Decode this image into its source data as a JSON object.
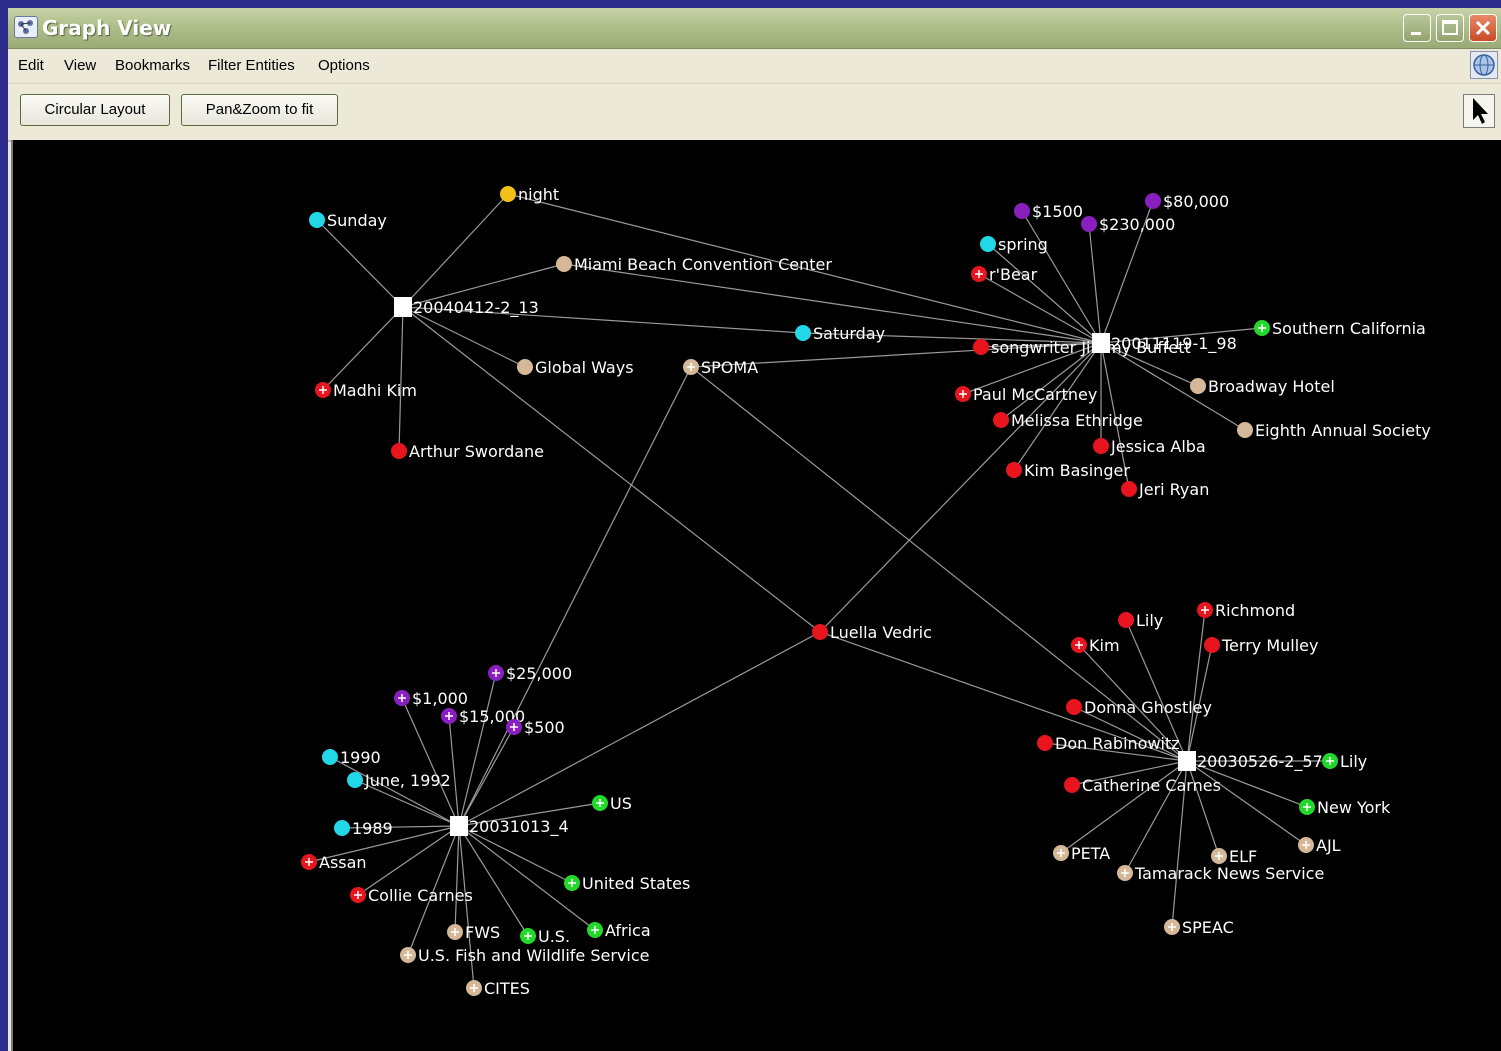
{
  "window": {
    "title": "Graph View"
  },
  "menu": {
    "items": [
      "Edit",
      "View",
      "Bookmarks",
      "Filter Entities",
      "Options"
    ]
  },
  "toolbar": {
    "circular_layout_label": "Circular Layout",
    "pan_zoom_label": "Pan&Zoom to fit",
    "pointer_icon": "arrow-pointer-icon"
  },
  "colors": {
    "window_bg": "#ece9d8",
    "canvas_bg": "#000000",
    "edge": "#9a9a9a",
    "person": "#e8141e",
    "money": "#8a1fc0",
    "date": "#22d7e6",
    "location": "#22d82a",
    "organization": "#d4b898",
    "time": "#f2c018",
    "document": "#ffffff"
  },
  "graph": {
    "nodes": [
      {
        "id": "d1",
        "label": "20040412-2_13",
        "type": "document"
      },
      {
        "id": "d2",
        "label": "20011119-1_98",
        "type": "document"
      },
      {
        "id": "d3",
        "label": "20031013_4",
        "type": "document"
      },
      {
        "id": "d4",
        "label": "20030526-2_57",
        "type": "document"
      },
      {
        "id": "n1",
        "label": "night",
        "type": "time"
      },
      {
        "id": "n2",
        "label": "Sunday",
        "type": "date"
      },
      {
        "id": "n3",
        "label": "Miami Beach Convention Center",
        "type": "organization"
      },
      {
        "id": "n4",
        "label": "Madhi Kim",
        "type": "person",
        "plus": true
      },
      {
        "id": "n5",
        "label": "Arthur Swordane",
        "type": "person"
      },
      {
        "id": "n6",
        "label": "Global Ways",
        "type": "organization"
      },
      {
        "id": "n7",
        "label": "Saturday",
        "type": "date"
      },
      {
        "id": "n8",
        "label": "SPOMA",
        "type": "organization",
        "plus": true
      },
      {
        "id": "n9",
        "label": "$1500",
        "type": "money"
      },
      {
        "id": "n10",
        "label": "$80,000",
        "type": "money"
      },
      {
        "id": "n11",
        "label": "$230,000",
        "type": "money"
      },
      {
        "id": "n12",
        "label": "spring",
        "type": "date"
      },
      {
        "id": "n13",
        "label": "r'Bear",
        "type": "person",
        "plus": true
      },
      {
        "id": "n14",
        "label": "songwriter Jimmy Buffett",
        "type": "person"
      },
      {
        "id": "n15",
        "label": "Southern California",
        "type": "location",
        "plus": true
      },
      {
        "id": "n16",
        "label": "Paul McCartney",
        "type": "person",
        "plus": true
      },
      {
        "id": "n17",
        "label": "Broadway Hotel",
        "type": "organization"
      },
      {
        "id": "n18",
        "label": "Melissa Ethridge",
        "type": "person"
      },
      {
        "id": "n19",
        "label": "Eighth Annual Society",
        "type": "organization"
      },
      {
        "id": "n20",
        "label": "Jessica Alba",
        "type": "person"
      },
      {
        "id": "n21",
        "label": "Kim Basinger",
        "type": "person"
      },
      {
        "id": "n22",
        "label": "Jeri Ryan",
        "type": "person"
      },
      {
        "id": "n23",
        "label": "Luella Vedric",
        "type": "person"
      },
      {
        "id": "n24",
        "label": "$25,000",
        "type": "money",
        "plus": true
      },
      {
        "id": "n25",
        "label": "$1,000",
        "type": "money",
        "plus": true
      },
      {
        "id": "n26",
        "label": "$15,000",
        "type": "money",
        "plus": true
      },
      {
        "id": "n27",
        "label": "$500",
        "type": "money",
        "plus": true
      },
      {
        "id": "n28",
        "label": "1990",
        "type": "date"
      },
      {
        "id": "n29",
        "label": "June, 1992",
        "type": "date"
      },
      {
        "id": "n30",
        "label": "US",
        "type": "location",
        "plus": true
      },
      {
        "id": "n31",
        "label": "1989",
        "type": "date"
      },
      {
        "id": "n32",
        "label": "Assan",
        "type": "person",
        "plus": true
      },
      {
        "id": "n33",
        "label": "Collie Carnes",
        "type": "person",
        "plus": true
      },
      {
        "id": "n34",
        "label": "United States",
        "type": "location",
        "plus": true
      },
      {
        "id": "n35",
        "label": "FWS",
        "type": "organization",
        "plus": true
      },
      {
        "id": "n36",
        "label": "U.S.",
        "type": "location",
        "plus": true
      },
      {
        "id": "n37",
        "label": "Africa",
        "type": "location",
        "plus": true
      },
      {
        "id": "n38",
        "label": "U.S. Fish and Wildlife Service",
        "type": "organization",
        "plus": true
      },
      {
        "id": "n39",
        "label": "CITES",
        "type": "organization",
        "plus": true
      },
      {
        "id": "n40",
        "label": "Lily",
        "type": "person"
      },
      {
        "id": "n41",
        "label": "Richmond",
        "type": "person",
        "plus": true
      },
      {
        "id": "n42",
        "label": "Kim",
        "type": "person",
        "plus": true
      },
      {
        "id": "n43",
        "label": "Terry Mulley",
        "type": "person"
      },
      {
        "id": "n44",
        "label": "Donna Ghostley",
        "type": "person"
      },
      {
        "id": "n45",
        "label": "Don Rabinowitz",
        "type": "person"
      },
      {
        "id": "n46",
        "label": "Lily",
        "type": "location",
        "plus": true
      },
      {
        "id": "n47",
        "label": "Catherine Carnes",
        "type": "person"
      },
      {
        "id": "n48",
        "label": "New York",
        "type": "location",
        "plus": true
      },
      {
        "id": "n49",
        "label": "AJL",
        "type": "organization",
        "plus": true
      },
      {
        "id": "n50",
        "label": "PETA",
        "type": "organization",
        "plus": true
      },
      {
        "id": "n51",
        "label": "ELF",
        "type": "organization",
        "plus": true
      },
      {
        "id": "n52",
        "label": "Tamarack News Service",
        "type": "organization",
        "plus": true
      },
      {
        "id": "n53",
        "label": "SPEAC",
        "type": "organization",
        "plus": true
      }
    ],
    "edges": [
      [
        "d1",
        "n1"
      ],
      [
        "d1",
        "n2"
      ],
      [
        "d1",
        "n3"
      ],
      [
        "d1",
        "n4"
      ],
      [
        "d1",
        "n5"
      ],
      [
        "d1",
        "n6"
      ],
      [
        "d1",
        "n7"
      ],
      [
        "d1",
        "n23"
      ],
      [
        "n1",
        "d2"
      ],
      [
        "n3",
        "d2"
      ],
      [
        "n7",
        "d2"
      ],
      [
        "n8",
        "d2"
      ],
      [
        "d2",
        "n9"
      ],
      [
        "d2",
        "n10"
      ],
      [
        "d2",
        "n11"
      ],
      [
        "d2",
        "n12"
      ],
      [
        "d2",
        "n13"
      ],
      [
        "d2",
        "n14"
      ],
      [
        "d2",
        "n15"
      ],
      [
        "d2",
        "n16"
      ],
      [
        "d2",
        "n17"
      ],
      [
        "d2",
        "n18"
      ],
      [
        "d2",
        "n19"
      ],
      [
        "d2",
        "n20"
      ],
      [
        "d2",
        "n21"
      ],
      [
        "d2",
        "n22"
      ],
      [
        "d2",
        "n23"
      ],
      [
        "n8",
        "d3"
      ],
      [
        "n8",
        "d4"
      ],
      [
        "n23",
        "d3"
      ],
      [
        "n23",
        "d4"
      ],
      [
        "d3",
        "n24"
      ],
      [
        "d3",
        "n25"
      ],
      [
        "d3",
        "n26"
      ],
      [
        "d3",
        "n27"
      ],
      [
        "d3",
        "n28"
      ],
      [
        "d3",
        "n29"
      ],
      [
        "d3",
        "n30"
      ],
      [
        "d3",
        "n31"
      ],
      [
        "d3",
        "n32"
      ],
      [
        "d3",
        "n33"
      ],
      [
        "d3",
        "n34"
      ],
      [
        "d3",
        "n35"
      ],
      [
        "d3",
        "n36"
      ],
      [
        "d3",
        "n37"
      ],
      [
        "d3",
        "n38"
      ],
      [
        "d3",
        "n39"
      ],
      [
        "d4",
        "n40"
      ],
      [
        "d4",
        "n41"
      ],
      [
        "d4",
        "n42"
      ],
      [
        "d4",
        "n43"
      ],
      [
        "d4",
        "n44"
      ],
      [
        "d4",
        "n45"
      ],
      [
        "d4",
        "n46"
      ],
      [
        "d4",
        "n47"
      ],
      [
        "d4",
        "n48"
      ],
      [
        "d4",
        "n49"
      ],
      [
        "d4",
        "n50"
      ],
      [
        "d4",
        "n51"
      ],
      [
        "d4",
        "n52"
      ],
      [
        "d4",
        "n53"
      ]
    ]
  }
}
